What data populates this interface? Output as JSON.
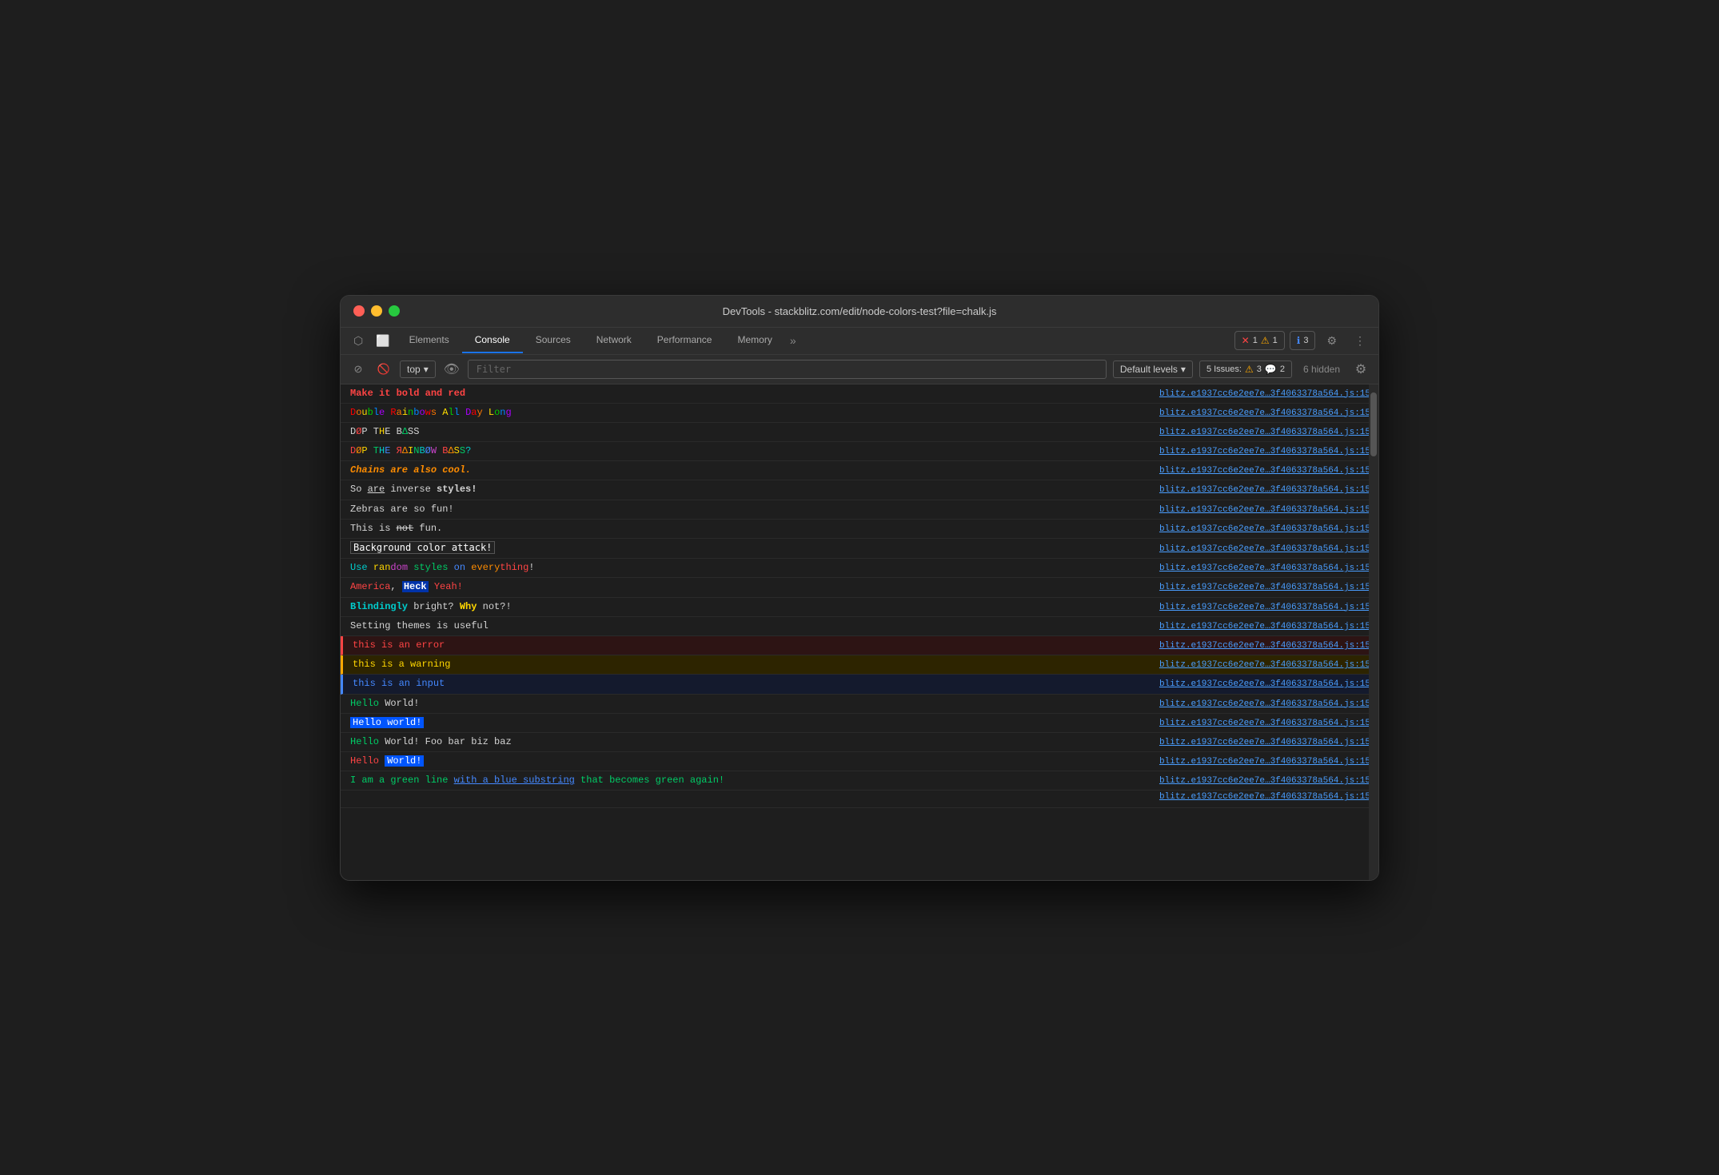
{
  "window": {
    "title": "DevTools - stackblitz.com/edit/node-colors-test?file=chalk.js"
  },
  "tabs": {
    "items": [
      {
        "label": "Elements",
        "active": false
      },
      {
        "label": "Console",
        "active": true
      },
      {
        "label": "Sources",
        "active": false
      },
      {
        "label": "Network",
        "active": false
      },
      {
        "label": "Performance",
        "active": false
      },
      {
        "label": "Memory",
        "active": false
      }
    ],
    "more_label": "»"
  },
  "toolbar": {
    "top_label": "top",
    "filter_placeholder": "Filter",
    "default_levels_label": "Default levels",
    "issues_label": "5 Issues:",
    "issues_count_warning": "3",
    "issues_count_info": "2",
    "hidden_label": "6 hidden"
  },
  "badges": {
    "error_count": "1",
    "warning_count": "1",
    "info_count": "3"
  },
  "source_link": "blitz.e1937cc6e2ee7e…3f4063378a564.js:15",
  "console_rows": [
    {
      "id": 1,
      "type": "default"
    },
    {
      "id": 2,
      "type": "default"
    },
    {
      "id": 3,
      "type": "default"
    },
    {
      "id": 4,
      "type": "default"
    },
    {
      "id": 5,
      "type": "default"
    },
    {
      "id": 6,
      "type": "default"
    },
    {
      "id": 7,
      "type": "default"
    },
    {
      "id": 8,
      "type": "default"
    },
    {
      "id": 9,
      "type": "default"
    },
    {
      "id": 10,
      "type": "default"
    },
    {
      "id": 11,
      "type": "default"
    },
    {
      "id": 12,
      "type": "default"
    },
    {
      "id": 13,
      "type": "error"
    },
    {
      "id": 14,
      "type": "warning"
    },
    {
      "id": 15,
      "type": "input"
    },
    {
      "id": 16,
      "type": "default"
    },
    {
      "id": 17,
      "type": "default"
    },
    {
      "id": 18,
      "type": "default"
    },
    {
      "id": 19,
      "type": "default"
    },
    {
      "id": 20,
      "type": "default"
    },
    {
      "id": 21,
      "type": "default"
    }
  ]
}
